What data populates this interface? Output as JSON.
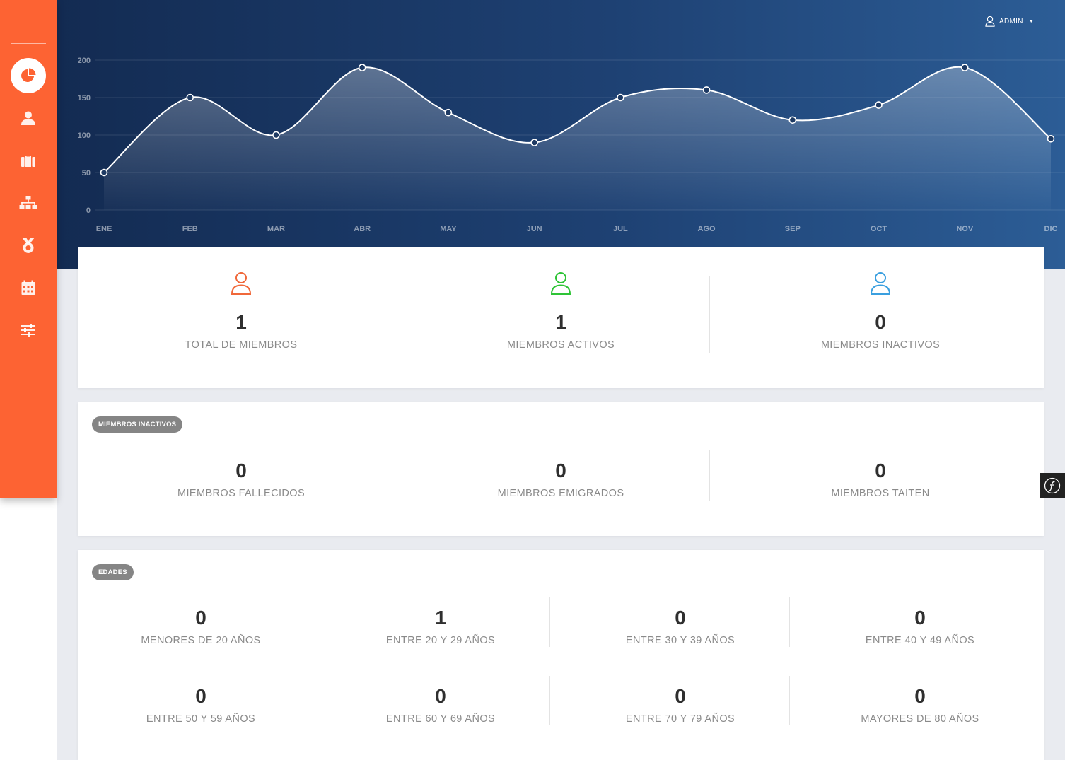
{
  "header": {
    "user_label": "ADMIN"
  },
  "chart_data": {
    "type": "area",
    "categories": [
      "ENE",
      "FEB",
      "MAR",
      "ABR",
      "MAY",
      "JUN",
      "JUL",
      "AGO",
      "SEP",
      "OCT",
      "NOV",
      "DIC"
    ],
    "values": [
      50,
      150,
      100,
      190,
      130,
      90,
      150,
      160,
      120,
      140,
      190,
      95
    ],
    "y_ticks": [
      "0",
      "50",
      "100",
      "150",
      "200"
    ],
    "ylim": [
      0,
      200
    ],
    "grid": true
  },
  "sidebar": {
    "items": [
      {
        "icon": "pie-chart-icon",
        "active": true
      },
      {
        "icon": "user-icon"
      },
      {
        "icon": "briefcase-icon"
      },
      {
        "icon": "sitemap-icon"
      },
      {
        "icon": "medal-icon"
      },
      {
        "icon": "calendar-icon"
      },
      {
        "icon": "sliders-icon"
      }
    ]
  },
  "summary": {
    "total": {
      "value": "1",
      "label": "TOTAL DE MIEMBROS",
      "color": "#f0683a"
    },
    "active": {
      "value": "1",
      "label": "MIEMBROS ACTIVOS",
      "color": "#2ec436"
    },
    "inactive": {
      "value": "0",
      "label": "MIEMBROS INACTIVOS",
      "color": "#3a9fdf"
    }
  },
  "inactive_section": {
    "badge": "MIEMBROS INACTIVOS",
    "stats": [
      {
        "value": "0",
        "label": "MIEMBROS FALLECIDOS"
      },
      {
        "value": "0",
        "label": "MIEMBROS EMIGRADOS"
      },
      {
        "value": "0",
        "label": "MIEMBROS TAITEN"
      }
    ]
  },
  "ages_section": {
    "badge": "EDADES",
    "stats": [
      {
        "value": "0",
        "label": "MENORES DE 20 AÑOS"
      },
      {
        "value": "1",
        "label": "ENTRE 20 Y 29 AÑOS"
      },
      {
        "value": "0",
        "label": "ENTRE 30 Y 39 AÑOS"
      },
      {
        "value": "0",
        "label": "ENTRE 40 Y 49 AÑOS"
      },
      {
        "value": "0",
        "label": "ENTRE 50 Y 59 AÑOS"
      },
      {
        "value": "0",
        "label": "ENTRE 60 Y 69 AÑOS"
      },
      {
        "value": "0",
        "label": "ENTRE 70 Y 79 AÑOS"
      },
      {
        "value": "0",
        "label": "MAYORES DE 80 AÑOS"
      }
    ]
  },
  "colors": {
    "sidebar": "#fd6333",
    "header_start": "#132b52",
    "header_end": "#2c5d96",
    "page_bg": "#e9ebf0"
  }
}
